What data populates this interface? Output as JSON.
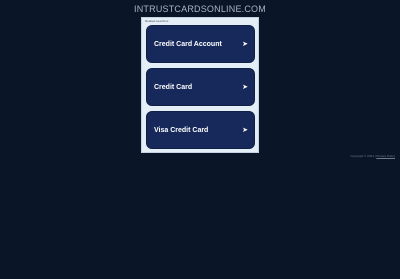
{
  "header": {
    "site_title": "INTRUSTCARDSONLINE.COM"
  },
  "panel": {
    "label": "Related searches",
    "links": [
      {
        "label": "Credit Card Account",
        "icon": "arrow-right-icon"
      },
      {
        "label": "Credit Card",
        "icon": "arrow-right-icon"
      },
      {
        "label": "Visa Credit Card",
        "icon": "arrow-right-icon"
      }
    ]
  },
  "footer": {
    "copyright": "Copyright © 2024 |",
    "privacy_link": "Privacy Policy"
  },
  "colors": {
    "background": "#0b1528",
    "panel": "#e4eef6",
    "button": "#16295a",
    "title_text": "#a9b3c6"
  }
}
